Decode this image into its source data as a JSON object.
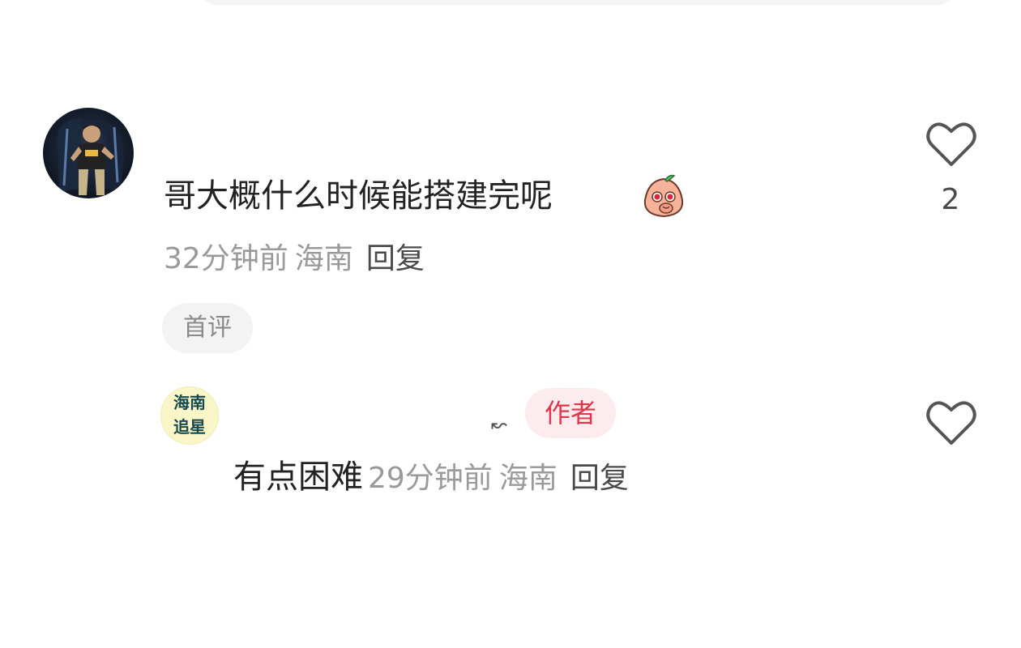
{
  "comment": {
    "text": "哥大概什么时候能搭建完呢",
    "time": "32分钟前",
    "location": "海南",
    "reply_label": "回复",
    "badge": "首评",
    "like_count": "2"
  },
  "reply": {
    "avatar_line1": "海南",
    "avatar_line2": "追星",
    "username_mark": "↜",
    "author_badge": "作者",
    "text": "有点困难",
    "time": "29分钟前",
    "location": "海南",
    "reply_label": "回复"
  },
  "icons": {
    "like": "heart-outline-icon",
    "emoji": "peach-emoji-icon"
  },
  "colors": {
    "author_badge_text": "#e0354a",
    "author_badge_bg": "#fdecee",
    "meta_text": "#9a9a9a",
    "avatar_reply_bg": "#fbf6c7"
  }
}
